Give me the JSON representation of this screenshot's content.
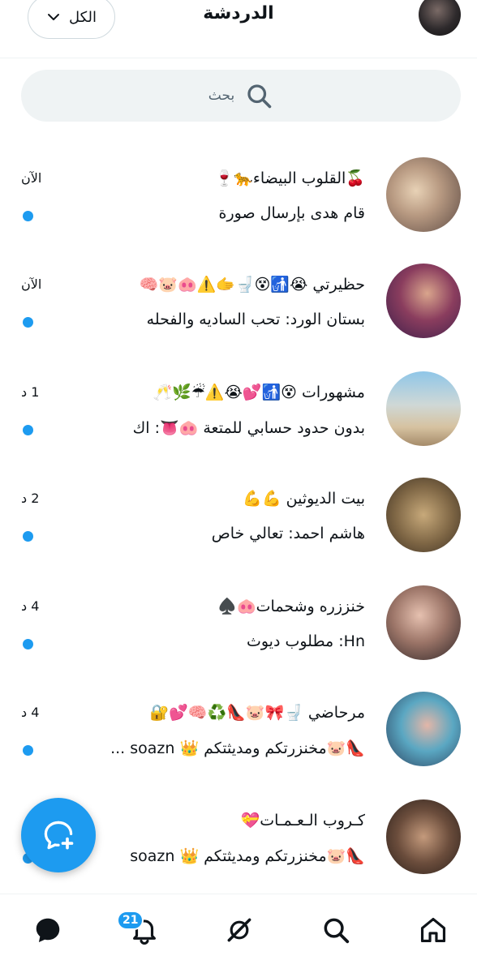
{
  "header": {
    "title": "الدردشة",
    "filter_label": "الكل"
  },
  "search": {
    "placeholder": "بحث"
  },
  "chats": [
    {
      "name": "🍒القلوب البيضاء🐆🍷",
      "preview": "قام هدى بإرسال صورة",
      "time": "الآن",
      "unread": true
    },
    {
      "name": "حظيرتي 😭🚮😵🚽🫱⚠️🐽🐷🧠",
      "preview": "بستان الورد: تحب الساديه والفحله",
      "time": "الآن",
      "unread": true
    },
    {
      "name": "مشهورات 😵🚮💕😭⚠️☔🌿🥂",
      "preview": "بدون حدود حسابي للمتعة 🐽👅: اك",
      "time": "1 د",
      "unread": true
    },
    {
      "name": "بيت الديوثين 💪💪",
      "preview": "هاشم احمد: تعالي خاص",
      "time": "2 د",
      "unread": true
    },
    {
      "name": "خنززره وشحمات🐽♠️",
      "preview": "Hn: مطلوب ديوث",
      "time": "4 د",
      "unread": true
    },
    {
      "name": "مرحاضي 🚽🎀🐷👠♻️🧠💕🔐",
      "preview": "👠🐷مخنزرتكم ومديثتكم 👑 soazn ...",
      "time": "4 د",
      "unread": true
    },
    {
      "name": "كـروب الـعـمـات💝",
      "preview": "👠🐷مخنزرتكم ومديثتكم 👑 soazn",
      "time": "",
      "unread": true
    }
  ],
  "notifications": {
    "badge_count": "21"
  },
  "icons": {
    "filter": "chevron-down-icon",
    "search": "search-icon",
    "fab": "new-message-icon",
    "nav": [
      "messages-icon",
      "notifications-icon",
      "communities-icon",
      "explore-icon",
      "home-icon"
    ]
  },
  "colors": {
    "accent": "#1d9bf0",
    "text": "#0f1419",
    "muted": "#536471",
    "search_bg": "#eff3f4"
  }
}
